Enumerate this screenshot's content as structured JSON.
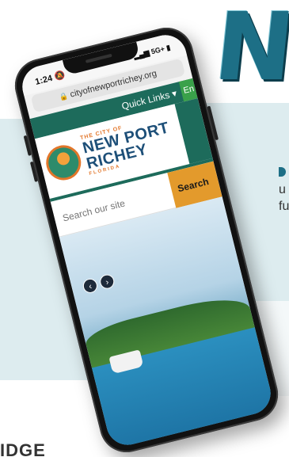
{
  "background": {
    "big_letter": "N",
    "side_text": "u e i fu n",
    "bottom_text": "IDGE"
  },
  "phone": {
    "status": {
      "time": "1:24",
      "network": "5G+"
    },
    "url": "cityofnewportrichey.org",
    "nav": {
      "quick_links": "Quick Links ▾",
      "language": "En"
    },
    "logo": {
      "small": "THE CITY OF",
      "line1": "NEW PORT",
      "line2": "RICHEY",
      "state": "FLORIDA"
    },
    "search": {
      "placeholder": "Search our site",
      "button": "Search"
    },
    "carousel": {
      "prev": "‹",
      "next": "›"
    }
  },
  "colors": {
    "teal": "#1d6b5b",
    "orange": "#e39a2c",
    "navy": "#1d4f78"
  }
}
